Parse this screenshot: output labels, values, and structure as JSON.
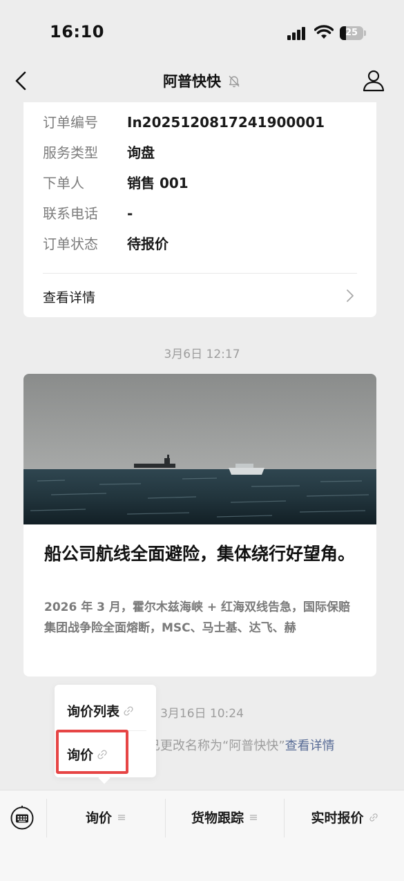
{
  "status_bar": {
    "time": "16:10",
    "battery": "25"
  },
  "header": {
    "title": "阿普快快"
  },
  "order": {
    "rows": [
      {
        "label": "订单编号",
        "value": "In2025120817241900001"
      },
      {
        "label": "服务类型",
        "value": "询盘"
      },
      {
        "label": "下单人",
        "value": "销售 001"
      },
      {
        "label": "联系电话",
        "value": "-"
      },
      {
        "label": "订单状态",
        "value": "待报价"
      }
    ],
    "detail_label": "查看详情"
  },
  "timestamp_1": "3月6日 12:17",
  "article": {
    "title": "船公司航线全面避险，集体绕行好望角。",
    "description": "2026 年 3 月，霍尔木兹海峡 + 红海双线告急，国际保赔集团战争险全面熔断，MSC、马士基、达飞、赫"
  },
  "timestamp_2": "3月16日 10:24",
  "notice": {
    "prefix": "公众号“阿普”已更改名称为“阿普快快”",
    "link": "查看详情"
  },
  "popup": {
    "items": [
      "询价列表",
      "询价"
    ]
  },
  "menu": {
    "items": [
      {
        "label": "询价",
        "icon": "menu-icon"
      },
      {
        "label": "货物跟踪",
        "icon": "menu-icon"
      },
      {
        "label": "实时报价",
        "icon": "link-icon"
      }
    ]
  },
  "colors": {
    "accent_link": "#576b95",
    "highlight": "#e64545",
    "background": "#ededed"
  }
}
